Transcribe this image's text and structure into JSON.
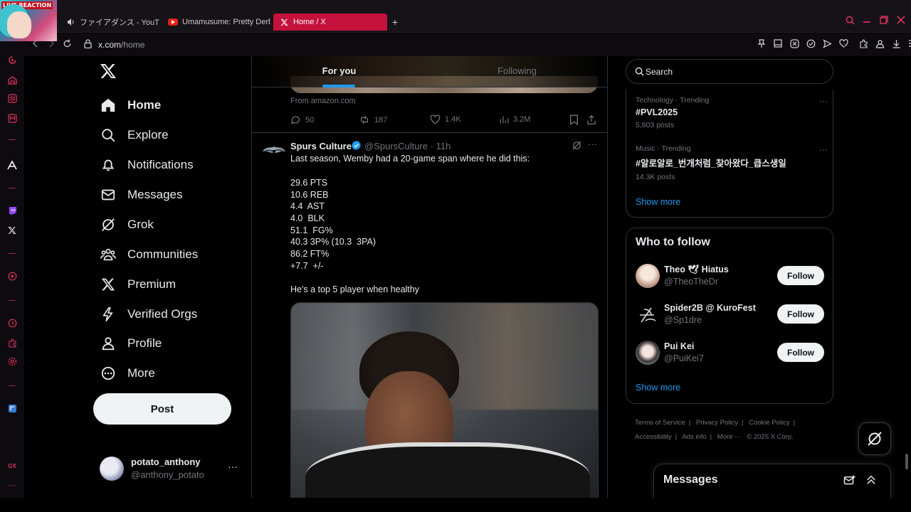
{
  "browser": {
    "stream_badge": "LIVE REACTION",
    "tabs": [
      {
        "label": "ファイアダンス - YouTube",
        "icon": "speaker-icon"
      },
      {
        "label": "Umamusume: Pretty Derby",
        "icon": "youtube-icon"
      },
      {
        "label": "Home / X",
        "icon": "x-logo-icon",
        "active": true
      }
    ],
    "url_host": "x.com",
    "url_path": "/home",
    "accent": "#e2325e"
  },
  "nav": {
    "items": [
      {
        "label": "Home",
        "icon": "home-icon",
        "active": true
      },
      {
        "label": "Explore",
        "icon": "search-icon"
      },
      {
        "label": "Notifications",
        "icon": "bell-icon"
      },
      {
        "label": "Messages",
        "icon": "mail-icon"
      },
      {
        "label": "Grok",
        "icon": "grok-icon"
      },
      {
        "label": "Communities",
        "icon": "people-icon"
      },
      {
        "label": "Premium",
        "icon": "x-logo-icon"
      },
      {
        "label": "Verified Orgs",
        "icon": "lightning-icon"
      },
      {
        "label": "Profile",
        "icon": "person-icon"
      },
      {
        "label": "More",
        "icon": "more-circle-icon"
      }
    ],
    "post_label": "Post",
    "account": {
      "name": "potato_anthony",
      "handle": "@anthony_potato"
    }
  },
  "timeline": {
    "tabs": {
      "for_you": "For you",
      "following": "Following"
    },
    "prev_post": {
      "source": "From amazon.com",
      "replies": "50",
      "reposts": "187",
      "likes": "1.4K",
      "views": "3.2M"
    },
    "tweet": {
      "name": "Spurs Culture",
      "handle": "@SpursCulture",
      "time": "· 11h",
      "lines": [
        "Last season, Wemby had a 20-game span where he did this:",
        "29.6 PTS",
        "10.6 REB",
        "4.4  AST",
        "4.0  BLK",
        "51.1  FG%",
        "40.3 3P% (10.3  3PA)",
        "86.2 FT%",
        "+7.7  +/-",
        "He's a top 5 player when healthy"
      ]
    }
  },
  "sidebar": {
    "search_placeholder": "Search",
    "trends": [
      {
        "meta": "Technology · Trending",
        "tag": "#PVL2025",
        "count": "5,803 posts"
      },
      {
        "meta": "Music · Trending",
        "tag": "#알로알로_번개처럼_찾아왔다_큽스생일",
        "count": "14.3K posts"
      }
    ],
    "trends_show_more": "Show more",
    "who_to_follow": {
      "title": "Who to follow",
      "accounts": [
        {
          "name": "Theo 🕊 Hiatus",
          "handle": "@TheoTheDr",
          "button": "Follow"
        },
        {
          "name": "Spider2B @ KuroFest",
          "handle": "@Sp1dre",
          "button": "Follow"
        },
        {
          "name": "Pui Kei",
          "handle": "@PuiKei7",
          "button": "Follow"
        }
      ],
      "show_more": "Show more"
    },
    "footer": {
      "terms": "Terms of Service",
      "privacy": "Privacy Policy",
      "cookie": "Cookie Policy",
      "accessibility": "Accessibility",
      "ads": "Ads info",
      "more": "More ···",
      "copyright": "© 2025 X Corp."
    }
  },
  "messages_drawer": {
    "title": "Messages"
  },
  "colors": {
    "link": "#1d9bf0",
    "muted": "#71767b",
    "text": "#e7e9ea",
    "border": "#2f3336"
  }
}
